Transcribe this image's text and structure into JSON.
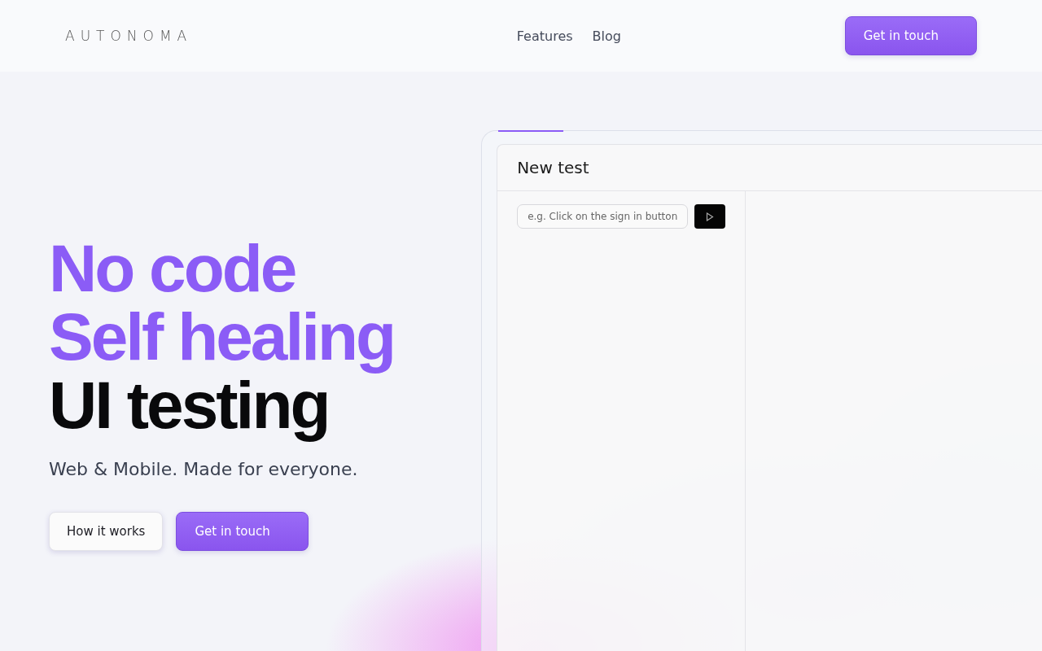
{
  "header": {
    "logo": "AUTONOMA",
    "nav": [
      "Features",
      "Blog"
    ],
    "cta": "Get in touch"
  },
  "hero": {
    "headline": [
      {
        "text": "No code",
        "accent": true
      },
      {
        "text": "Self healing",
        "accent": true
      },
      {
        "text": "UI testing",
        "accent": false
      }
    ],
    "subtitle": "Web & Mobile. Made for everyone.",
    "buttons": [
      {
        "label": "How it works",
        "kind": "secondary"
      },
      {
        "label": "Get in touch",
        "kind": "primary"
      }
    ]
  },
  "app_preview": {
    "title": "New test",
    "prompt": {
      "placeholder": "e.g. Click on the sign in button"
    }
  }
}
